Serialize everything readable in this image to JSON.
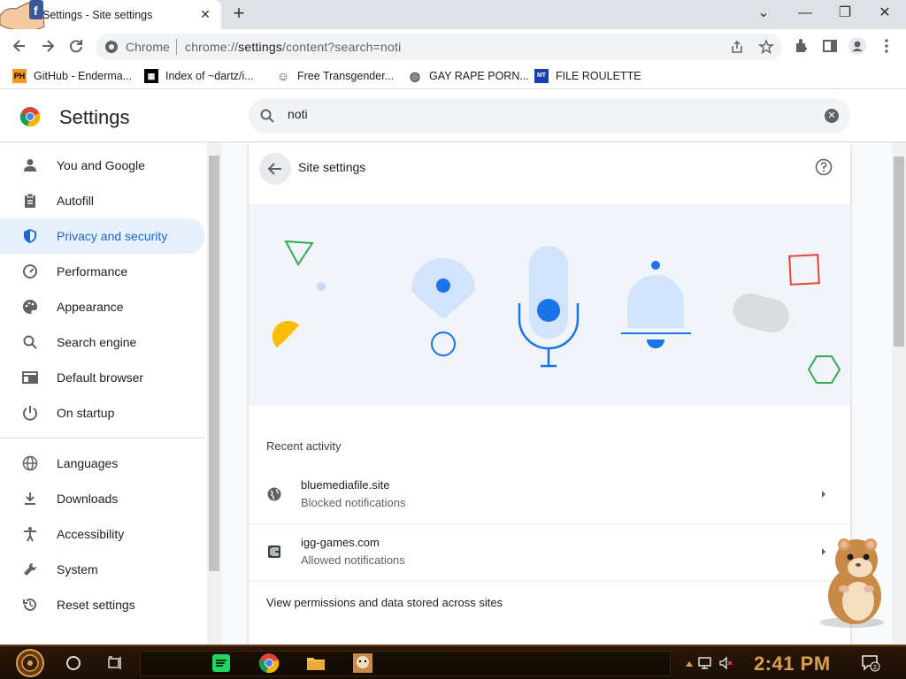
{
  "tab": {
    "title": "Settings - Site settings",
    "close": "✕",
    "new_tab": "+"
  },
  "window_controls": {
    "minimize": "—",
    "maximize": "❐",
    "close": "✕",
    "tab_search": "⌄"
  },
  "omnibox": {
    "site_label": "Chrome",
    "url_prefix": "chrome://",
    "url_bold": "settings",
    "url_rest": "/content?search=noti"
  },
  "bookmarks": [
    {
      "label": "GitHub - Enderma...",
      "icon": "PH",
      "icon_bg": "#f7971d",
      "icon_color": "#000"
    },
    {
      "label": "Index of ~dartz/i...",
      "icon": "▦",
      "icon_bg": "#000",
      "icon_color": "#fff"
    },
    {
      "label": "Free Transgender...",
      "icon": "☺",
      "icon_bg": "#fff",
      "icon_color": "#444"
    },
    {
      "label": "GAY RAPE PORN...",
      "icon": "◍",
      "icon_bg": "#fff",
      "icon_color": "#555"
    },
    {
      "label": "FILE ROULETTE",
      "icon": "MT",
      "icon_bg": "#1a3fb0",
      "icon_color": "#fff"
    }
  ],
  "settings": {
    "title": "Settings",
    "search_value": "noti",
    "search_clear": "✕"
  },
  "sidebar": {
    "items": [
      {
        "label": "You and Google",
        "icon": "person-icon"
      },
      {
        "label": "Autofill",
        "icon": "clipboard-icon"
      },
      {
        "label": "Privacy and security",
        "icon": "shield-icon",
        "active": true
      },
      {
        "label": "Performance",
        "icon": "speedometer-icon"
      },
      {
        "label": "Appearance",
        "icon": "palette-icon"
      },
      {
        "label": "Search engine",
        "icon": "search-icon"
      },
      {
        "label": "Default browser",
        "icon": "browser-icon"
      },
      {
        "label": "On startup",
        "icon": "power-icon"
      },
      {
        "label": "Languages",
        "icon": "globe-icon"
      },
      {
        "label": "Downloads",
        "icon": "download-icon"
      },
      {
        "label": "Accessibility",
        "icon": "accessibility-icon"
      },
      {
        "label": "System",
        "icon": "wrench-icon"
      },
      {
        "label": "Reset settings",
        "icon": "history-icon"
      }
    ]
  },
  "page": {
    "title": "Site settings",
    "recent_label": "Recent activity",
    "rows": [
      {
        "site": "bluemediafile.site",
        "detail": "Blocked notifications",
        "icon": "globe-icon"
      },
      {
        "site": "igg-games.com",
        "detail": "Allowed notifications",
        "icon": "site-favicon-icon"
      }
    ],
    "view_all": "View permissions and data stored across sites"
  },
  "taskbar": {
    "time": "2:41 PM",
    "notification_count": "2"
  },
  "colors": {
    "accent": "#1a73e8",
    "active_bg": "#e8f0fe",
    "active_text": "#1967d2",
    "taskbar_time": "#d7a04c"
  }
}
